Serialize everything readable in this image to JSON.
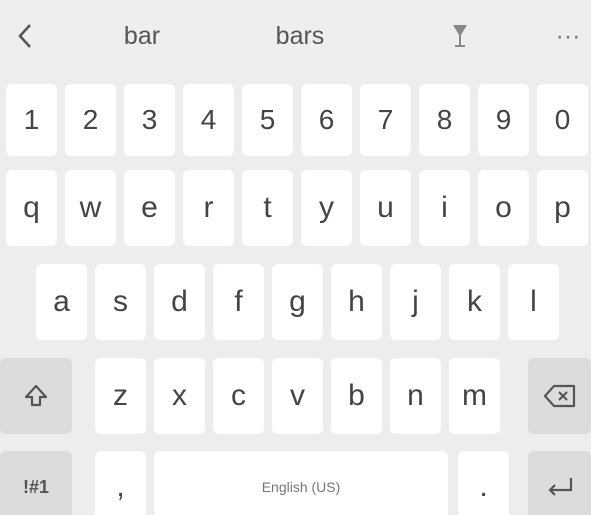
{
  "suggestions": {
    "back_icon": "chevron-left-icon",
    "items": [
      "bar",
      "bars"
    ],
    "mic_icon": "microphone-icon",
    "more": "···"
  },
  "rows": {
    "numbers": [
      "1",
      "2",
      "3",
      "4",
      "5",
      "6",
      "7",
      "8",
      "9",
      "0"
    ],
    "row1": [
      "q",
      "w",
      "e",
      "r",
      "t",
      "y",
      "u",
      "i",
      "o",
      "p"
    ],
    "row2": [
      "a",
      "s",
      "d",
      "f",
      "g",
      "h",
      "j",
      "k",
      "l"
    ],
    "row3": [
      "z",
      "x",
      "c",
      "v",
      "b",
      "n",
      "m"
    ]
  },
  "bottom": {
    "symbols": "!#1",
    "comma": ",",
    "space": "English (US)",
    "period": ".",
    "enter_icon": "enter-icon"
  },
  "modifiers": {
    "shift_icon": "shift-icon",
    "backspace_icon": "backspace-icon"
  }
}
